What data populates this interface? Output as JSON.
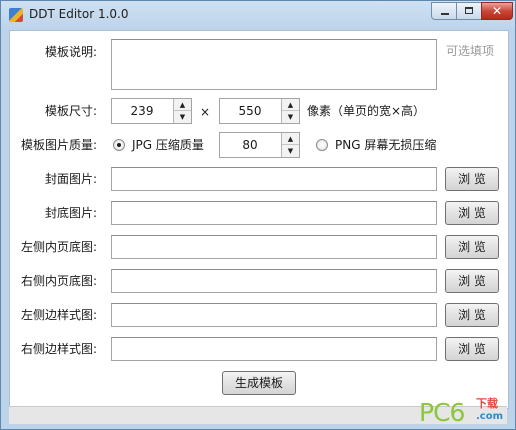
{
  "window": {
    "title": "DDT Editor 1.0.0",
    "close_glyph": "✕"
  },
  "labels": {
    "desc": "模板说明:",
    "size": "模板尺寸:",
    "quality": "模板图片质量:",
    "cover": "封面图片:",
    "backcover": "封底图片:",
    "left_inner": "左侧内页底图:",
    "right_inner": "右侧内页底图:",
    "left_side": "左侧边样式图:",
    "right_side": "右侧边样式图:"
  },
  "desc_field": {
    "value": "",
    "hint": "可选填项"
  },
  "size": {
    "width": "239",
    "height": "550",
    "times": "×",
    "unit": "像素（单页的宽×高）"
  },
  "quality": {
    "jpg_label": "JPG 压缩质量",
    "jpg_value": "80",
    "png_label": "PNG 屏幕无损压缩",
    "selected": "jpg"
  },
  "browse_label": "浏 览",
  "generate_label": "生成模板",
  "spin_icons": {
    "up": "▲",
    "down": "▼"
  },
  "watermark": {
    "main": "PC6",
    "sub": "下载",
    "domain": ".com"
  }
}
